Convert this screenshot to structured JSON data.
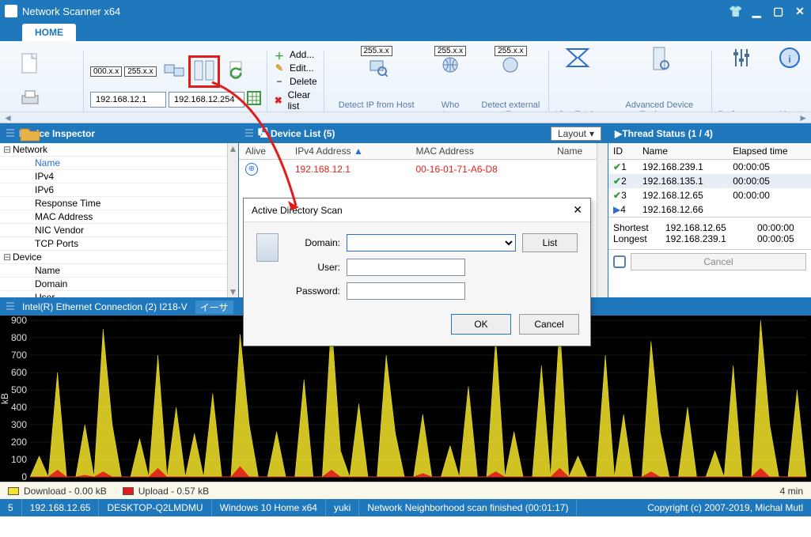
{
  "window": {
    "title": "Network Scanner x64"
  },
  "tabs": {
    "home": "HOME"
  },
  "ribbon": {
    "ghost1": "000.x.x",
    "ghost2": "255.x.x",
    "ip_from": "192.168.12.1",
    "ip_to": "192.168.12.254",
    "add": "Add...",
    "edit": "Edit...",
    "delete": "Delete",
    "clear": "Clear list",
    "detect_ip": "Detect IP from Host name...",
    "whois": "Who Is...",
    "detect_ext": "Detect external IP...",
    "virustotal": "VirusTotal...",
    "adv": "Advanced Device Explorer...",
    "prefs": "Preferences",
    "about": "About",
    "badge255": "255.x.x"
  },
  "inspector": {
    "title": "Device Inspector",
    "col_name": "Name",
    "cat_network": "Network",
    "cat_device": "Device",
    "net_fields": [
      "Name",
      "IPv4",
      "IPv6",
      "Response Time",
      "MAC Address",
      "NIC Vendor",
      "TCP Ports"
    ],
    "dev_fields": [
      "Name",
      "Domain",
      "User"
    ]
  },
  "devlist": {
    "title": "Device List (5)",
    "layout_label": "Layout",
    "cols": {
      "alive": "Alive",
      "ipv4": "IPv4 Address",
      "mac": "MAC Address",
      "name": "Name"
    },
    "row": {
      "ip": "192.168.12.1",
      "mac": "00-16-01-71-A6-D8"
    }
  },
  "threads": {
    "title": "Thread Status (1 / 4)",
    "cols": {
      "id": "ID",
      "name": "Name",
      "elapsed": "Elapsed time"
    },
    "rows": [
      {
        "id": "1",
        "name": "192.168.239.1",
        "elapsed": "00:00:05",
        "state": "done"
      },
      {
        "id": "2",
        "name": "192.168.135.1",
        "elapsed": "00:00:05",
        "state": "done"
      },
      {
        "id": "3",
        "name": "192.168.12.65",
        "elapsed": "00:00:00",
        "state": "done"
      },
      {
        "id": "4",
        "name": "192.168.12.66",
        "elapsed": "",
        "state": "running"
      }
    ],
    "shortest_l": "Shortest",
    "shortest_v": "192.168.12.65",
    "shortest_t": "00:00:00",
    "longest_l": "Longest",
    "longest_v": "192.168.239.1",
    "longest_t": "00:00:05",
    "cancel": "Cancel"
  },
  "graph": {
    "nic": "Intel(R) Ethernet Connection (2) I218-V",
    "nic2": "イーサ",
    "dl_label": "Download - 0.00 kB",
    "ul_label": "Upload - 0.57 kB",
    "span": "4 min",
    "yunit": "kB"
  },
  "status": {
    "count": "5",
    "ip": "192.168.12.65",
    "host": "DESKTOP-Q2LMDMU",
    "os": "Windows 10 Home x64",
    "user": "yuki",
    "msg": "Network Neighborhood scan finished (00:01:17)",
    "copy": "Copyright (c) 2007-2019, Michal Mutl"
  },
  "dlg": {
    "title": "Active Directory Scan",
    "domain_l": "Domain:",
    "user_l": "User:",
    "pass_l": "Password:",
    "list": "List",
    "ok": "OK",
    "cancel": "Cancel"
  },
  "chart_data": {
    "type": "area",
    "ylabel": "kB",
    "ylim": [
      0,
      900
    ],
    "yticks": [
      0,
      100,
      200,
      300,
      400,
      500,
      600,
      700,
      800,
      900
    ],
    "x_span_label": "4 min",
    "series": [
      {
        "name": "Download",
        "color": "#f4e428",
        "values": [
          0,
          120,
          0,
          600,
          0,
          0,
          300,
          0,
          850,
          300,
          0,
          0,
          220,
          0,
          700,
          0,
          400,
          0,
          250,
          0,
          480,
          0,
          0,
          820,
          300,
          0,
          0,
          260,
          0,
          0,
          560,
          0,
          0,
          900,
          150,
          0,
          420,
          0,
          0,
          700,
          250,
          0,
          0,
          360,
          0,
          0,
          180,
          0,
          520,
          0,
          0,
          800,
          0,
          260,
          0,
          0,
          640,
          0,
          880,
          0,
          120,
          0,
          0,
          700,
          0,
          360,
          0,
          0,
          780,
          260,
          0,
          0,
          400,
          0,
          0,
          150,
          0,
          640,
          0,
          0,
          900,
          300,
          0,
          0,
          500,
          0
        ]
      },
      {
        "name": "Upload",
        "color": "#e21b1b",
        "values": [
          0,
          0,
          0,
          40,
          0,
          0,
          10,
          0,
          30,
          0,
          0,
          0,
          0,
          0,
          50,
          0,
          0,
          0,
          0,
          0,
          0,
          0,
          0,
          60,
          0,
          0,
          0,
          0,
          0,
          0,
          0,
          0,
          0,
          40,
          0,
          0,
          0,
          0,
          0,
          0,
          0,
          0,
          0,
          20,
          0,
          0,
          0,
          0,
          0,
          0,
          0,
          30,
          0,
          0,
          0,
          0,
          0,
          0,
          50,
          0,
          0,
          0,
          0,
          0,
          0,
          0,
          0,
          0,
          30,
          0,
          0,
          0,
          0,
          0,
          0,
          0,
          0,
          0,
          0,
          0,
          50,
          0,
          0,
          0,
          0,
          0
        ]
      }
    ]
  }
}
